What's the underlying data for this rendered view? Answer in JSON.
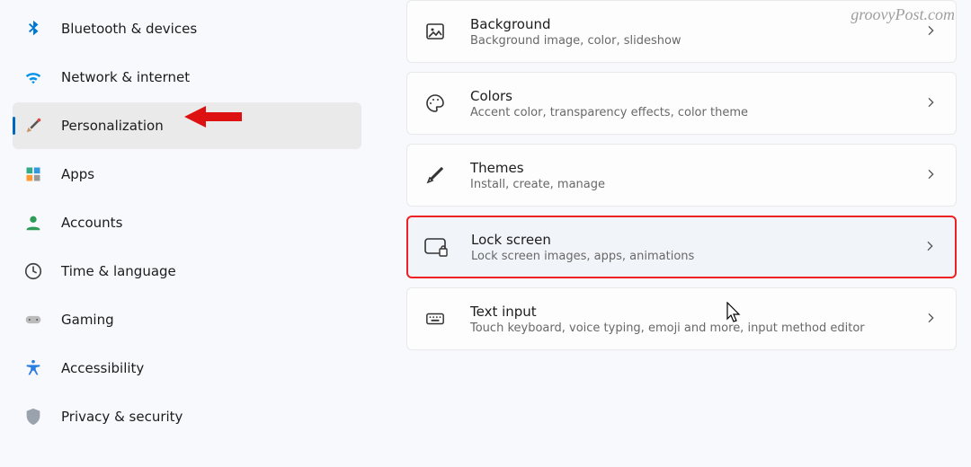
{
  "watermark": "groovyPost.com",
  "sidebar": {
    "items": [
      {
        "label": "Bluetooth & devices"
      },
      {
        "label": "Network & internet"
      },
      {
        "label": "Personalization"
      },
      {
        "label": "Apps"
      },
      {
        "label": "Accounts"
      },
      {
        "label": "Time & language"
      },
      {
        "label": "Gaming"
      },
      {
        "label": "Accessibility"
      },
      {
        "label": "Privacy & security"
      }
    ]
  },
  "main": {
    "cards": [
      {
        "title": "Background",
        "sub": "Background image, color, slideshow"
      },
      {
        "title": "Colors",
        "sub": "Accent color, transparency effects, color theme"
      },
      {
        "title": "Themes",
        "sub": "Install, create, manage"
      },
      {
        "title": "Lock screen",
        "sub": "Lock screen images, apps, animations"
      },
      {
        "title": "Text input",
        "sub": "Touch keyboard, voice typing, emoji and more, input method editor"
      }
    ]
  }
}
